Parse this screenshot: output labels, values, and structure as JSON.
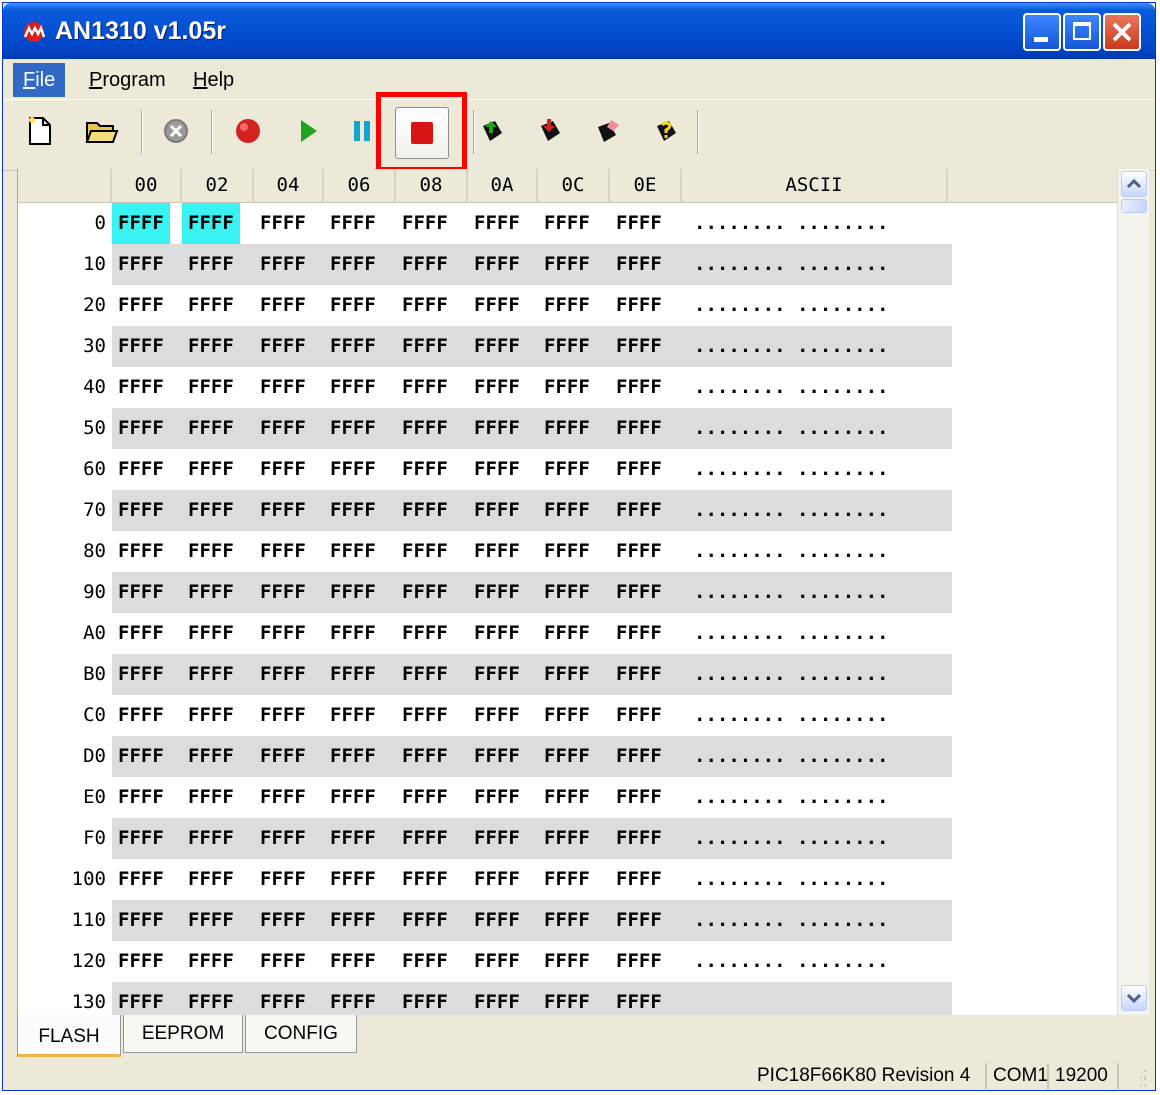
{
  "window": {
    "title": "AN1310 v1.05r"
  },
  "menu": [
    {
      "label": "File",
      "mnemonic": "F",
      "rest": "ile"
    },
    {
      "label": "Program",
      "mnemonic": "P",
      "rest": "rogram"
    },
    {
      "label": "Help",
      "mnemonic": "H",
      "rest": "elp"
    }
  ],
  "toolbar": {
    "icons": [
      "new-file-icon",
      "open-folder-icon",
      "abort-icon",
      "record-icon",
      "run-icon",
      "pause-icon",
      "stop-icon",
      "read-device-icon",
      "write-device-icon",
      "erase-device-icon",
      "verify-device-icon"
    ],
    "highlighted": "stop-icon"
  },
  "grid": {
    "headers": [
      "00",
      "02",
      "04",
      "06",
      "08",
      "0A",
      "0C",
      "0E",
      "ASCII"
    ],
    "rows": [
      {
        "addr": "0",
        "cells": [
          "FFFF",
          "FFFF",
          "FFFF",
          "FFFF",
          "FFFF",
          "FFFF",
          "FFFF",
          "FFFF"
        ],
        "ascii": "........ ........"
      },
      {
        "addr": "10",
        "cells": [
          "FFFF",
          "FFFF",
          "FFFF",
          "FFFF",
          "FFFF",
          "FFFF",
          "FFFF",
          "FFFF"
        ],
        "ascii": "........ ........"
      },
      {
        "addr": "20",
        "cells": [
          "FFFF",
          "FFFF",
          "FFFF",
          "FFFF",
          "FFFF",
          "FFFF",
          "FFFF",
          "FFFF"
        ],
        "ascii": "........ ........"
      },
      {
        "addr": "30",
        "cells": [
          "FFFF",
          "FFFF",
          "FFFF",
          "FFFF",
          "FFFF",
          "FFFF",
          "FFFF",
          "FFFF"
        ],
        "ascii": "........ ........"
      },
      {
        "addr": "40",
        "cells": [
          "FFFF",
          "FFFF",
          "FFFF",
          "FFFF",
          "FFFF",
          "FFFF",
          "FFFF",
          "FFFF"
        ],
        "ascii": "........ ........"
      },
      {
        "addr": "50",
        "cells": [
          "FFFF",
          "FFFF",
          "FFFF",
          "FFFF",
          "FFFF",
          "FFFF",
          "FFFF",
          "FFFF"
        ],
        "ascii": "........ ........"
      },
      {
        "addr": "60",
        "cells": [
          "FFFF",
          "FFFF",
          "FFFF",
          "FFFF",
          "FFFF",
          "FFFF",
          "FFFF",
          "FFFF"
        ],
        "ascii": "........ ........"
      },
      {
        "addr": "70",
        "cells": [
          "FFFF",
          "FFFF",
          "FFFF",
          "FFFF",
          "FFFF",
          "FFFF",
          "FFFF",
          "FFFF"
        ],
        "ascii": "........ ........"
      },
      {
        "addr": "80",
        "cells": [
          "FFFF",
          "FFFF",
          "FFFF",
          "FFFF",
          "FFFF",
          "FFFF",
          "FFFF",
          "FFFF"
        ],
        "ascii": "........ ........"
      },
      {
        "addr": "90",
        "cells": [
          "FFFF",
          "FFFF",
          "FFFF",
          "FFFF",
          "FFFF",
          "FFFF",
          "FFFF",
          "FFFF"
        ],
        "ascii": "........ ........"
      },
      {
        "addr": "A0",
        "cells": [
          "FFFF",
          "FFFF",
          "FFFF",
          "FFFF",
          "FFFF",
          "FFFF",
          "FFFF",
          "FFFF"
        ],
        "ascii": "........ ........"
      },
      {
        "addr": "B0",
        "cells": [
          "FFFF",
          "FFFF",
          "FFFF",
          "FFFF",
          "FFFF",
          "FFFF",
          "FFFF",
          "FFFF"
        ],
        "ascii": "........ ........"
      },
      {
        "addr": "C0",
        "cells": [
          "FFFF",
          "FFFF",
          "FFFF",
          "FFFF",
          "FFFF",
          "FFFF",
          "FFFF",
          "FFFF"
        ],
        "ascii": "........ ........"
      },
      {
        "addr": "D0",
        "cells": [
          "FFFF",
          "FFFF",
          "FFFF",
          "FFFF",
          "FFFF",
          "FFFF",
          "FFFF",
          "FFFF"
        ],
        "ascii": "........ ........"
      },
      {
        "addr": "E0",
        "cells": [
          "FFFF",
          "FFFF",
          "FFFF",
          "FFFF",
          "FFFF",
          "FFFF",
          "FFFF",
          "FFFF"
        ],
        "ascii": "........ ........"
      },
      {
        "addr": "F0",
        "cells": [
          "FFFF",
          "FFFF",
          "FFFF",
          "FFFF",
          "FFFF",
          "FFFF",
          "FFFF",
          "FFFF"
        ],
        "ascii": "........ ........"
      },
      {
        "addr": "100",
        "cells": [
          "FFFF",
          "FFFF",
          "FFFF",
          "FFFF",
          "FFFF",
          "FFFF",
          "FFFF",
          "FFFF"
        ],
        "ascii": "........ ........"
      },
      {
        "addr": "110",
        "cells": [
          "FFFF",
          "FFFF",
          "FFFF",
          "FFFF",
          "FFFF",
          "FFFF",
          "FFFF",
          "FFFF"
        ],
        "ascii": "........ ........"
      },
      {
        "addr": "120",
        "cells": [
          "FFFF",
          "FFFF",
          "FFFF",
          "FFFF",
          "FFFF",
          "FFFF",
          "FFFF",
          "FFFF"
        ],
        "ascii": "........ ........"
      },
      {
        "addr": "130",
        "cells": [
          "FFFF",
          "FFFF",
          "FFFF",
          "FFFF",
          "FFFF",
          "FFFF",
          "FFFF",
          "FFFF"
        ],
        "ascii": ""
      }
    ]
  },
  "tabs": [
    "FLASH",
    "EEPROM",
    "CONFIG"
  ],
  "status": {
    "device": "PIC18F66K80 Revision 4",
    "port": "COM1",
    "baud": "19200"
  },
  "colors": {
    "selection": "#38f3f2",
    "highlight_box": "#ff0000",
    "title_bar": "#0553d3"
  }
}
